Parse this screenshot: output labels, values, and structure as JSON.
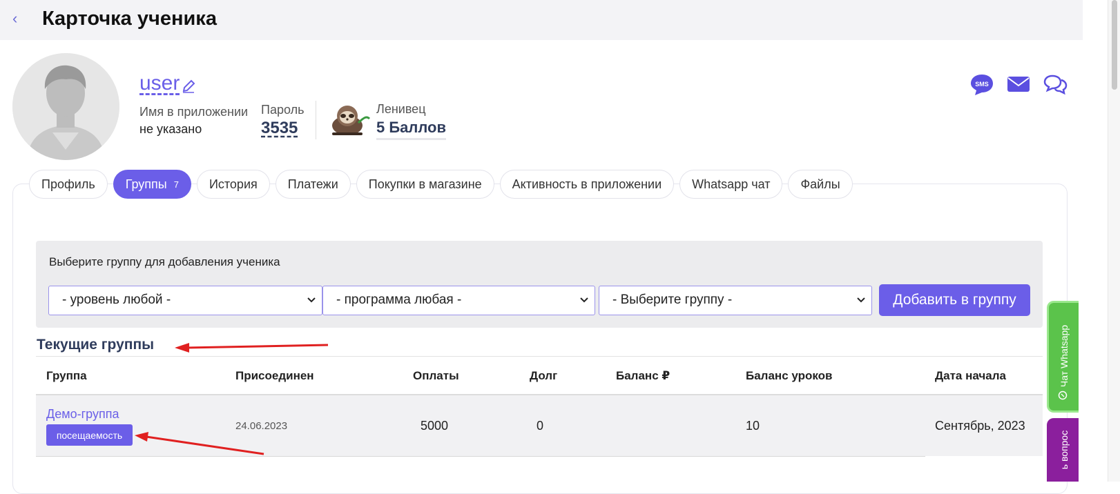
{
  "header": {
    "back_icon": "chevron-left-icon",
    "title": "Карточка ученика"
  },
  "profile": {
    "username": "user",
    "app_name_label": "Имя в приложении",
    "app_name_value": "не указано",
    "password_label": "Пароль",
    "password_value": "3535",
    "rank_label": "Ленивец",
    "points_value": "5 Баллов"
  },
  "contact_icons": [
    "sms-icon",
    "mail-icon",
    "chat-icon"
  ],
  "tabs": [
    {
      "label": "Профиль"
    },
    {
      "label": "Группы",
      "count": "7",
      "active": true
    },
    {
      "label": "История"
    },
    {
      "label": "Платежи"
    },
    {
      "label": "Покупки в магазине"
    },
    {
      "label": "Активность в приложении"
    },
    {
      "label": "Whatsapp чат"
    },
    {
      "label": "Файлы"
    }
  ],
  "add_group": {
    "label": "Выберите группу для добавления ученика",
    "level_select": "- уровень любой -",
    "program_select": "- программа любая -",
    "group_select": "- Выберите группу -",
    "button": "Добавить в группу"
  },
  "current_groups": {
    "title": "Текущие группы",
    "columns": [
      "Группа",
      "Присоединен",
      "Оплаты",
      "Долг",
      "Баланс ₽",
      "Баланс уроков",
      "Дата начала"
    ],
    "rows": [
      {
        "group": "Демо-группа",
        "badge": "посещаемость",
        "joined": "24.06.2023",
        "payments": "5000",
        "debt": "0",
        "balance": "",
        "lessons_balance": "10",
        "start_date": "Сентябрь, 2023"
      }
    ]
  },
  "side_widgets": {
    "whatsapp": "Чат Whatsapp",
    "question": "ь вопрос"
  },
  "colors": {
    "accent": "#6b5ee8",
    "link": "#6a5fe8",
    "whatsapp": "#5bc34b",
    "question": "#8b1f9d",
    "annotation": "#e02020"
  }
}
